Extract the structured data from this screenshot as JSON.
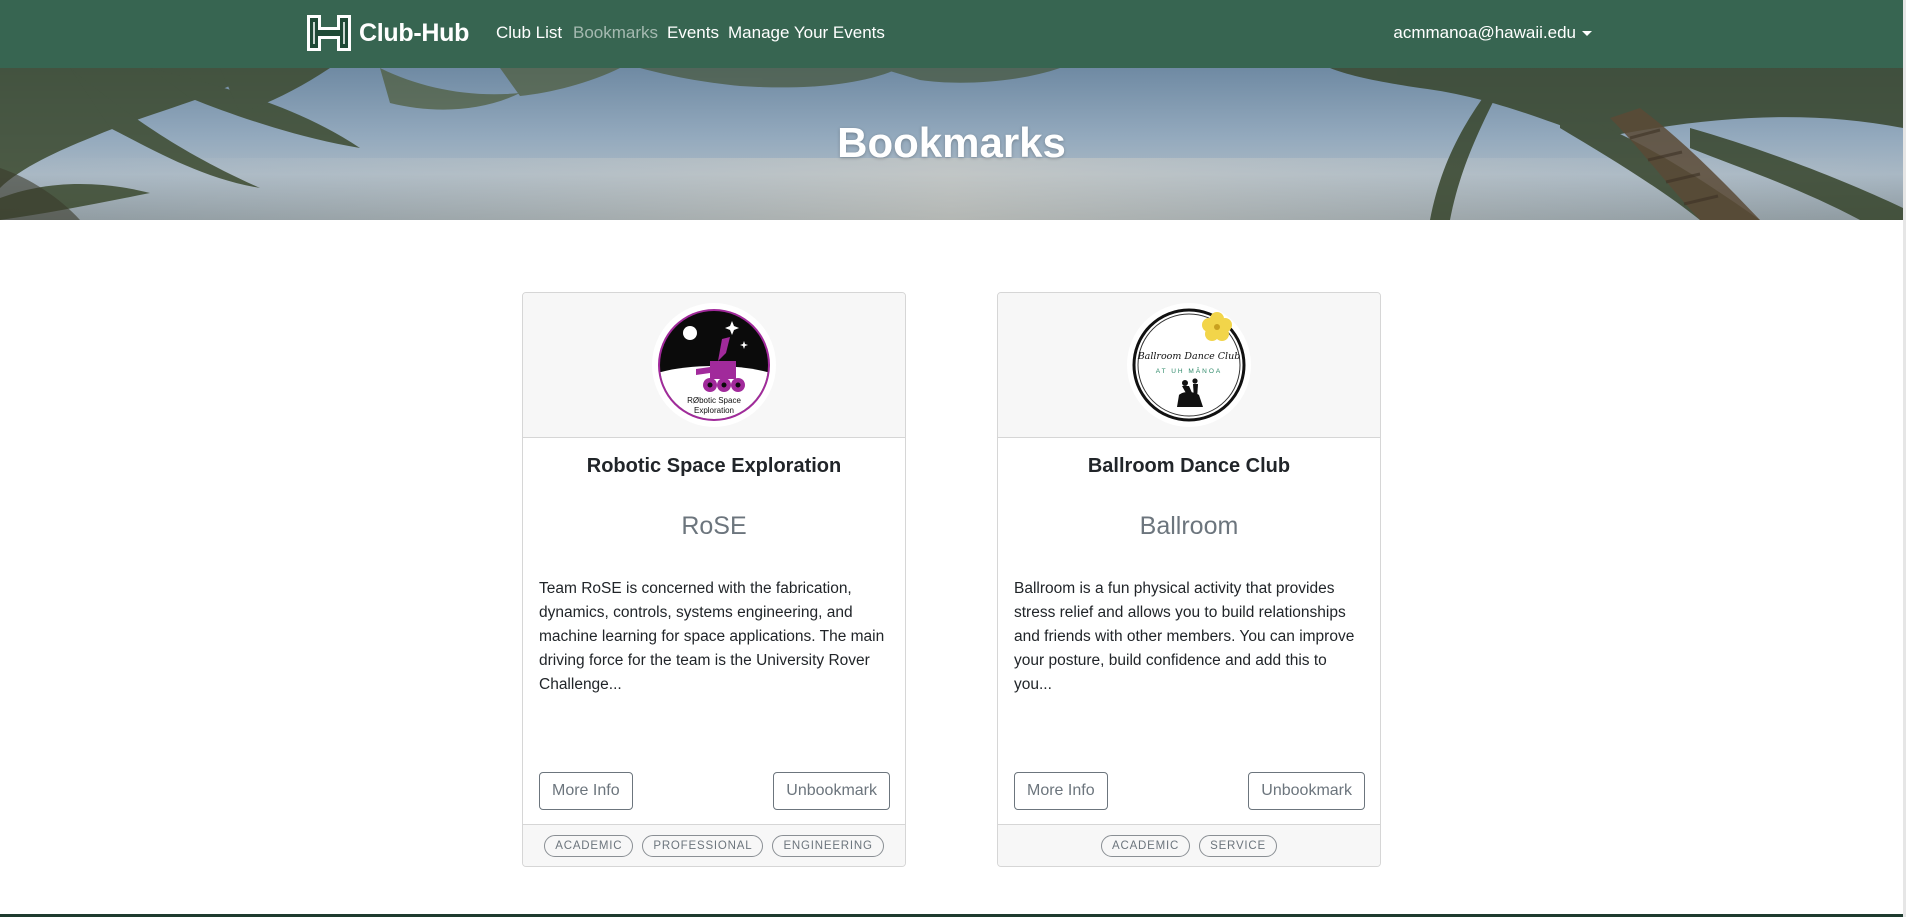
{
  "navbar": {
    "brand": "Club-Hub",
    "links": [
      "Club List",
      "Bookmarks",
      "Events",
      "Manage Your Events"
    ],
    "active_link": "Bookmarks",
    "user": "acmmanoa@hawaii.edu"
  },
  "banner": {
    "title": "Bookmarks"
  },
  "cards": [
    {
      "title": "Robotic Space Exploration",
      "subtitle": "RoSE",
      "description": "Team RoSE is concerned with the fabrication, dynamics, controls, systems engineering, and machine learning for space applications. The main driving force for the team is the University Rover Challenge...",
      "more_info": "More Info",
      "unbookmark": "Unbookmark",
      "tags": [
        "ACADEMIC",
        "PROFESSIONAL",
        "ENGINEERING"
      ],
      "logo_text": [
        "RØbotic Space",
        "Exploration"
      ]
    },
    {
      "title": "Ballroom Dance Club",
      "subtitle": "Ballroom",
      "description": "Ballroom is a fun physical activity that provides stress relief and allows you to build relationships and friends with other members. You can improve your posture, build confidence and add this to you...",
      "more_info": "More Info",
      "unbookmark": "Unbookmark",
      "tags": [
        "ACADEMIC",
        "SERVICE"
      ],
      "logo_text": [
        "Ballroom Dance Club",
        "AT UH MĀNOA"
      ]
    }
  ],
  "colors": {
    "navbar_bg": "#376551",
    "accent_text": "#6c757d",
    "card_header_bg": "#f7f7f7"
  }
}
